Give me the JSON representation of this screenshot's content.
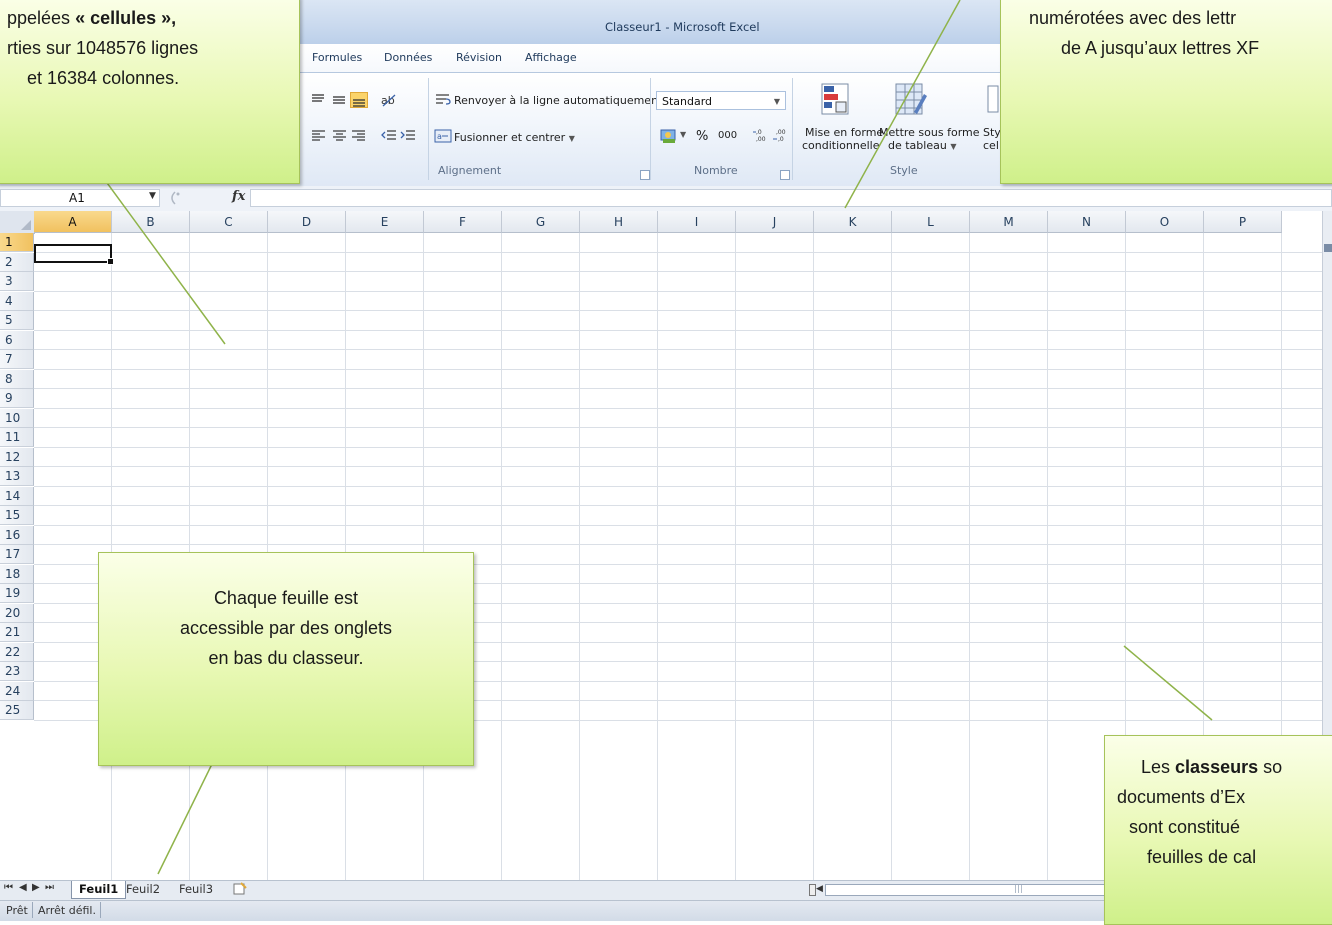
{
  "window": {
    "title": "Classeur1  -  Microsoft Excel"
  },
  "ribbon": {
    "tabs": [
      "Formules",
      "Données",
      "Révision",
      "Affichage"
    ],
    "alignment": {
      "wrap_text": "Renvoyer à la ligne automatiquement",
      "merge_center": "Fusionner et centrer",
      "group_label": "Alignement"
    },
    "number": {
      "format_value": "Standard",
      "percent": "%",
      "thousands": "000",
      "group_label": "Nombre"
    },
    "style": {
      "conditional_line1": "Mise en forme",
      "conditional_line2": "conditionnelle",
      "table_line1": "Mettre sous forme",
      "table_line2": "de tableau",
      "cell_styles_line1": "Sty",
      "cell_styles_line2": "cel",
      "group_label": "Style"
    }
  },
  "formula_bar": {
    "name_box": "A1",
    "fx": "fx",
    "formula": ""
  },
  "grid": {
    "columns": [
      "A",
      "B",
      "C",
      "D",
      "E",
      "F",
      "G",
      "H",
      "I",
      "J",
      "K",
      "L",
      "M",
      "N",
      "O",
      "P"
    ],
    "rows": [
      "1",
      "2",
      "3",
      "4",
      "5",
      "6",
      "7",
      "8",
      "9",
      "10",
      "11",
      "12",
      "13",
      "14",
      "15",
      "16",
      "17",
      "18",
      "19",
      "20",
      "21",
      "22",
      "23",
      "24",
      "25"
    ],
    "active_cell": "A1"
  },
  "sheet_tabs": {
    "tabs": [
      "Feuil1",
      "Feuil2",
      "Feuil3"
    ],
    "active": "Feuil1"
  },
  "status_bar": {
    "ready": "Prêt",
    "scroll_lock": "Arrêt défil."
  },
  "callouts": {
    "cells": {
      "line1_prefix": "ppelées ",
      "line1_bold": "« cellules »,",
      "line2": "rties sur 1048576 lignes",
      "line3": "et 16384 colonnes."
    },
    "columns": {
      "line1": "numérotées avec des lettr",
      "line2": "de A jusqu’aux lettres XF"
    },
    "tabs": {
      "line1": "Chaque feuille est",
      "line2": "accessible par des onglets",
      "line3": "en bas du classeur."
    },
    "workbooks": {
      "line1_prefix": "Les ",
      "line1_bold": "classeurs",
      "line1_suffix": " so",
      "line2": "documents d’Ex",
      "line3": "sont constitué",
      "line4": "feuilles de cal"
    }
  },
  "colors": {
    "callout_fill": "#e8f8b4",
    "callout_border": "#a6c35a",
    "leader_line": "#8fb34a",
    "active_header": "#f1c15f"
  }
}
